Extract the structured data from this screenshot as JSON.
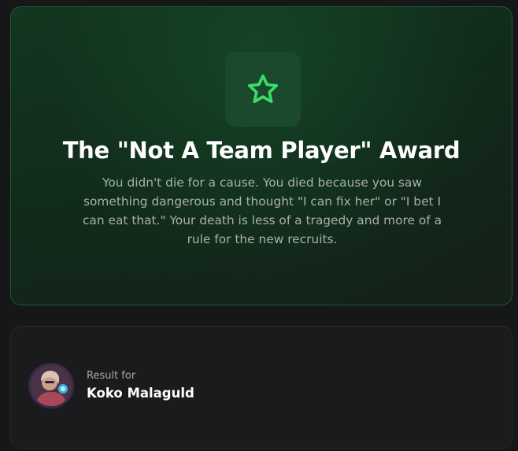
{
  "award": {
    "icon": "star-icon",
    "title": "The \"Not A Team Player\" Award",
    "description": "You didn't die for a cause. You died because you saw something dangerous and thought \"I can fix her\" or \"I bet I can eat that.\" Your death is less of a tragedy and more of a rule for the new recruits.",
    "accent_color": "#3ddc6e"
  },
  "result": {
    "label": "Result for",
    "name": "Koko Malaguld"
  }
}
